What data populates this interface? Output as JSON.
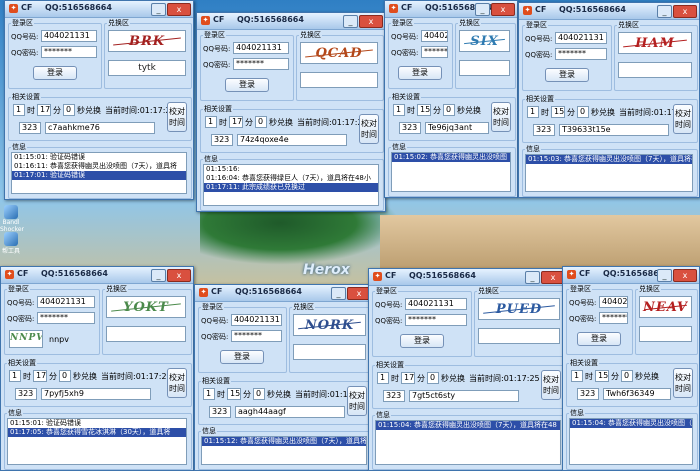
{
  "app": {
    "name": "CF",
    "qq_title": "QQ:516568664",
    "min_label": "_",
    "close_label": "x"
  },
  "labels": {
    "login_group": "登录区",
    "captcha_group": "兑换区",
    "qq_label": "QQ号码:",
    "pwd_label": "QQ密码:",
    "login_btn": "登录",
    "settings_group": "相关设置",
    "hour": "时",
    "minute": "分",
    "sec_exchange": "秒兑换",
    "calib_btn": "校对\n时间",
    "log_group": "信息"
  },
  "desktop": {
    "herox": "Herox",
    "icons": [
      "Bandl\nShocker",
      "帮工具"
    ]
  },
  "windows": [
    {
      "qq": "404021131",
      "pwd": "*******",
      "captcha": "BRK",
      "cap_color": "#a3201f",
      "answer": "tytk",
      "h": "1",
      "m": "17",
      "s": "0",
      "now": "当前时间:01:17:26",
      "num": "323",
      "code": "c7aahkme76",
      "logs": [
        {
          "t": "01:15:01: 验证码错误",
          "sel": false
        },
        {
          "t": "01:16:11: 恭喜您获得幽灵出没喷图（7天），道具将",
          "sel": false
        },
        {
          "t": "01:17:01: 验证码错误",
          "sel": true
        }
      ]
    },
    {
      "qq": "404021131",
      "pwd": "*******",
      "captcha": "QCAD",
      "cap_color": "#b4481a",
      "answer": "",
      "h": "1",
      "m": "17",
      "s": "0",
      "now": "当前时间:01:17:25",
      "num": "323",
      "code": "74z4qoxe4e",
      "logs": [
        {
          "t": "01:15:16:",
          "sel": false
        },
        {
          "t": "01:16:04: 恭喜您获得绿巨人（7天），道具将在48小",
          "sel": false
        },
        {
          "t": "01:17:11: 此宗成绩获已兑换过",
          "sel": true
        }
      ]
    },
    {
      "qq": "404021131",
      "pwd": "*******",
      "captcha": "SIX",
      "cap_color": "#2f7bb1",
      "answer": "",
      "h": "1",
      "m": "15",
      "s": "0",
      "now": "当前时间:01:17:26",
      "num": "323",
      "code": "Te96jq3ant",
      "logs": [
        {
          "t": "01:15:02: 恭喜您获得幽灵出没喷图（7天），道具将在4",
          "sel": true
        }
      ]
    },
    {
      "qq": "404021131",
      "pwd": "*******",
      "captcha": "HAM",
      "cap_color": "#b42020",
      "answer": "",
      "h": "1",
      "m": "15",
      "s": "0",
      "now": "当前时间:01:17:26",
      "num": "323",
      "code": "T39633t15e",
      "logs": [
        {
          "t": "01:15:03: 恭喜您获得幽灵出没喷图（7天），道具将在4",
          "sel": true
        }
      ]
    },
    {
      "qq": "404021131",
      "pwd": "*******",
      "captcha": "YOKT",
      "cap_color": "#4b8a4b",
      "answer": "nnpv",
      "cap2": "NNPV",
      "h": "1",
      "m": "17",
      "s": "0",
      "now": "当前时间:01:17:25",
      "num": "323",
      "code": "7pyfj5xh9",
      "logs": [
        {
          "t": "01:15:01: 验证码错误",
          "sel": false
        },
        {
          "t": "01:17:05: 恭喜您获得雪花冰淇淋（30天），道具将",
          "sel": true
        }
      ]
    },
    {
      "qq": "404021131",
      "pwd": "*******",
      "captcha": "NORK",
      "cap_color": "#2f4f8f",
      "answer": "",
      "h": "1",
      "m": "15",
      "s": "0",
      "now": "当前时间:01:17:26",
      "num": "323",
      "code": "aagh44aagf",
      "logs": [
        {
          "t": "01:15:12: 恭喜您获得幽灵出没喷图（7天），道具将在48",
          "sel": true
        }
      ]
    },
    {
      "qq": "404021131",
      "pwd": "*******",
      "captcha": "PUED",
      "cap_color": "#2c5aa0",
      "answer": "",
      "h": "1",
      "m": "17",
      "s": "0",
      "now": "当前时间:01:17:25",
      "num": "323",
      "code": "7gt5ct6sty",
      "logs": [
        {
          "t": "01:15:04: 恭喜您获得幽灵出没喷图（7天），道具将在48",
          "sel": true
        }
      ]
    },
    {
      "qq": "404021131",
      "pwd": "*******",
      "captcha": "NEAV",
      "cap_color": "#b42020",
      "answer": "",
      "h": "1",
      "m": "15",
      "s": "0",
      "now": "当前时间:01:17:25",
      "num": "323",
      "code": "Twh6f36349",
      "logs": [
        {
          "t": "01:15:04: 恭喜您获得幽灵出没喷图（7天），道具将在4",
          "sel": true
        }
      ]
    }
  ]
}
